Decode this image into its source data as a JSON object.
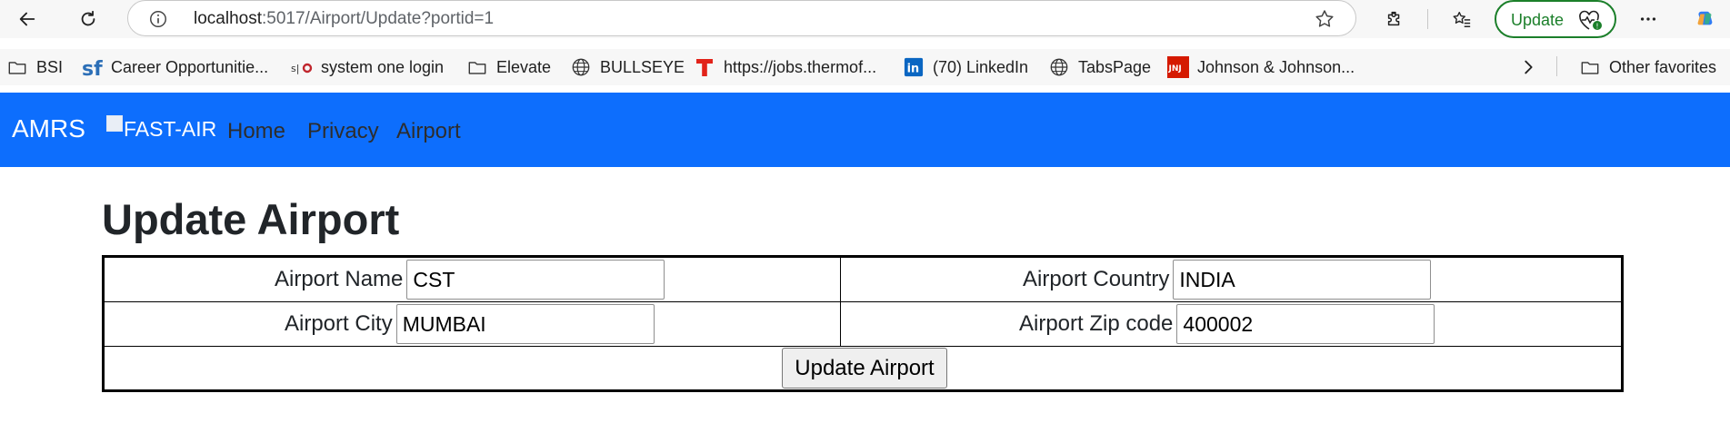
{
  "browser": {
    "url_host": "localhost",
    "url_rest": ":5017/Airport/Update?portid=1",
    "update_label": "Update"
  },
  "favorites": [
    {
      "label": "BSI",
      "icon": "folder-icon"
    },
    {
      "label": "Career Opportunitie...",
      "icon": "sf-icon"
    },
    {
      "label": "system one login",
      "icon": "s1o-icon"
    },
    {
      "label": "Elevate",
      "icon": "folder-icon"
    },
    {
      "label": "BULLSEYE",
      "icon": "globe-icon"
    },
    {
      "label": "https://jobs.thermof...",
      "icon": "t-icon"
    },
    {
      "label": "(70) LinkedIn",
      "icon": "linkedin-icon"
    },
    {
      "label": "TabsPage",
      "icon": "globe-icon"
    },
    {
      "label": "Johnson & Johnson...",
      "icon": "jnj-icon"
    },
    {
      "label": "Other favorites",
      "icon": "folder-icon"
    }
  ],
  "navbar": {
    "brand": "AMRS",
    "logo_alt": "FAST-AIR",
    "links": [
      "Home",
      "Privacy",
      "Airport"
    ]
  },
  "page": {
    "title": "Update Airport",
    "fields": {
      "name_label": "Airport Name",
      "name_value": "CST",
      "country_label": "Airport Country",
      "country_value": "INDIA",
      "city_label": "Airport City",
      "city_value": "MUMBAI",
      "zip_label": "Airport Zip code",
      "zip_value": "400002"
    },
    "submit_label": "Update Airport"
  },
  "colors": {
    "navbar": "#0d6efd",
    "update_pill": "#1b7f2a"
  }
}
